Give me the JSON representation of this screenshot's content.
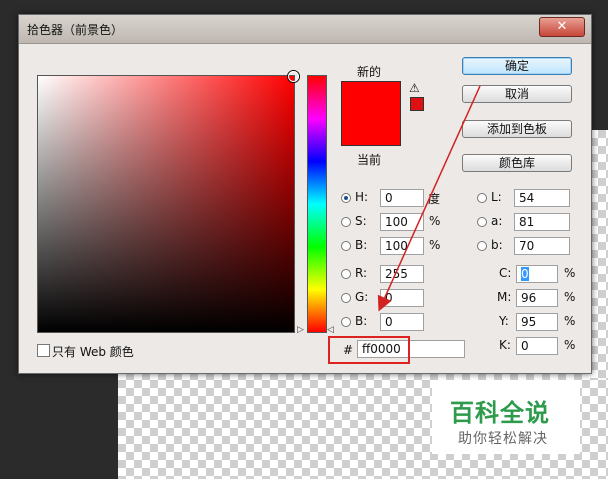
{
  "window": {
    "title": "拾色器（前景色）",
    "close_glyph": "✕"
  },
  "preview": {
    "new_label": "新的",
    "current_label": "当前",
    "new_color": "#ff0000",
    "current_color": "#ff0000",
    "warn_glyph": "⚠"
  },
  "buttons": {
    "ok": "确定",
    "cancel": "取消",
    "add_swatch": "添加到色板",
    "libraries": "颜色库"
  },
  "hsb": {
    "h": {
      "label": "H:",
      "value": "0",
      "unit": "度"
    },
    "s": {
      "label": "S:",
      "value": "100",
      "unit": "%"
    },
    "b": {
      "label": "B:",
      "value": "100",
      "unit": "%"
    }
  },
  "rgb": {
    "r": {
      "label": "R:",
      "value": "255"
    },
    "g": {
      "label": "G:",
      "value": "0"
    },
    "b": {
      "label": "B:",
      "value": "0"
    }
  },
  "lab": {
    "l": {
      "label": "L:",
      "value": "54"
    },
    "a": {
      "label": "a:",
      "value": "81"
    },
    "b": {
      "label": "b:",
      "value": "70"
    }
  },
  "cmyk": {
    "c": {
      "label": "C:",
      "value": "0",
      "unit": "%"
    },
    "m": {
      "label": "M:",
      "value": "96",
      "unit": "%"
    },
    "y": {
      "label": "Y:",
      "value": "95",
      "unit": "%"
    },
    "k": {
      "label": "K:",
      "value": "0",
      "unit": "%"
    }
  },
  "hex": {
    "label": "#",
    "value": "ff0000"
  },
  "web_only": {
    "label": "只有 Web 颜色",
    "checked": false
  },
  "watermark": {
    "title": "百科全说",
    "subtitle": "助你轻松解决"
  },
  "colors": {
    "annotation_red": "#d22222",
    "watermark_green": "#2d9a4c"
  }
}
